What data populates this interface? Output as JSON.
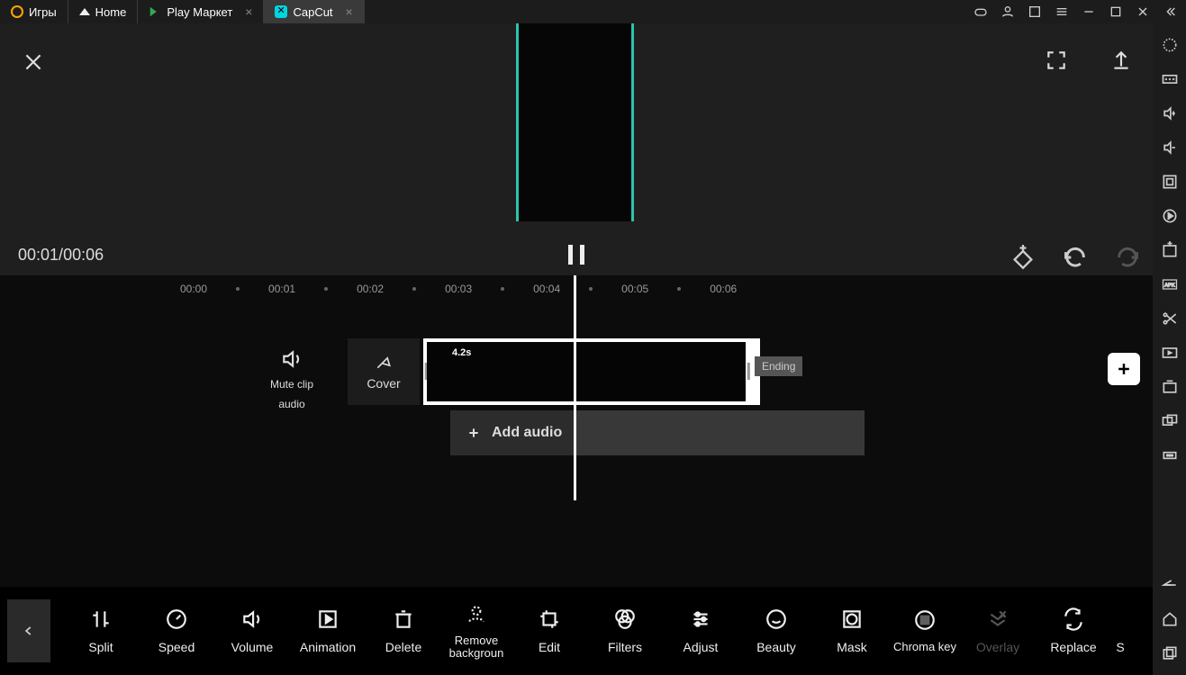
{
  "titlebar": {
    "tabs": [
      {
        "label": "Игры"
      },
      {
        "label": "Home"
      },
      {
        "label": "Play Маркет"
      },
      {
        "label": "CapCut"
      }
    ]
  },
  "preview": {
    "time_current": "00:01",
    "time_total": "00:06"
  },
  "ruler": {
    "ticks": [
      "00:00",
      "00:01",
      "00:02",
      "00:03",
      "00:04",
      "00:05",
      "00:06"
    ]
  },
  "tracks": {
    "mute_label_1": "Mute clip",
    "mute_label_2": "audio",
    "cover_label": "Cover",
    "clip_duration": "4.2s",
    "ending_label": "Ending",
    "add_audio_label": "Add audio"
  },
  "toolbar": {
    "items": [
      {
        "label": "Split"
      },
      {
        "label": "Speed"
      },
      {
        "label": "Volume"
      },
      {
        "label": "Animation"
      },
      {
        "label": "Delete"
      },
      {
        "label": "Remove backgroun"
      },
      {
        "label": "Edit"
      },
      {
        "label": "Filters"
      },
      {
        "label": "Adjust"
      },
      {
        "label": "Beauty"
      },
      {
        "label": "Mask"
      },
      {
        "label": "Chroma key"
      },
      {
        "label": "Overlay"
      },
      {
        "label": "Replace"
      },
      {
        "label": "S"
      }
    ]
  }
}
